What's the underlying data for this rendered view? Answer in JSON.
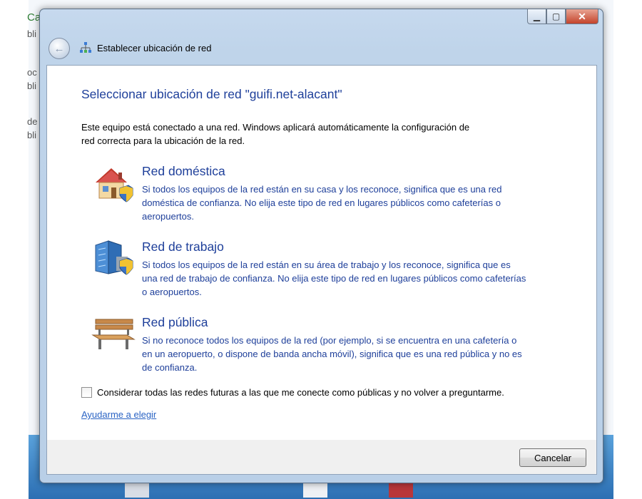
{
  "background": {
    "left_fragments": [
      "Ca",
      "bli",
      "oc",
      "bli",
      "de",
      "bli"
    ]
  },
  "window": {
    "title": "Establecer ubicación de red",
    "controls": {
      "minimize": "▁",
      "maximize": "▢",
      "close": "✕"
    }
  },
  "main": {
    "heading": "Seleccionar ubicación de red \"guifi.net-alacant\"",
    "intro": "Este equipo está conectado a una red. Windows aplicará automáticamente la configuración de red correcta para la ubicación de la red.",
    "options": [
      {
        "title": "Red doméstica",
        "description": "Si todos los equipos de la red están en su casa y los reconoce, significa que es una red doméstica de confianza. No elija este tipo de red en lugares públicos como cafeterías o aeropuertos.",
        "icon": "home-network-icon"
      },
      {
        "title": "Red de trabajo",
        "description": "Si todos los equipos de la red están en su área de trabajo y los reconoce, significa que es una red de trabajo de confianza. No elija este tipo de red en lugares públicos como cafeterías o aeropuertos.",
        "icon": "work-network-icon"
      },
      {
        "title": "Red pública",
        "description": "Si no reconoce todos los equipos de la red (por ejemplo, si se encuentra en una cafetería o en un aeropuerto, o dispone de banda ancha móvil), significa que es una red pública y no es de confianza.",
        "icon": "public-network-icon"
      }
    ],
    "checkbox_label": "Considerar todas las redes futuras a las que me conecte como públicas y no volver a preguntarme.",
    "checkbox_checked": false,
    "help_link": "Ayudarme a elegir"
  },
  "footer": {
    "cancel_label": "Cancelar"
  },
  "colors": {
    "heading": "#1e3f9a",
    "link": "#2a63c4",
    "frame": "#bfd4ea",
    "close_button": "#c4432b"
  }
}
